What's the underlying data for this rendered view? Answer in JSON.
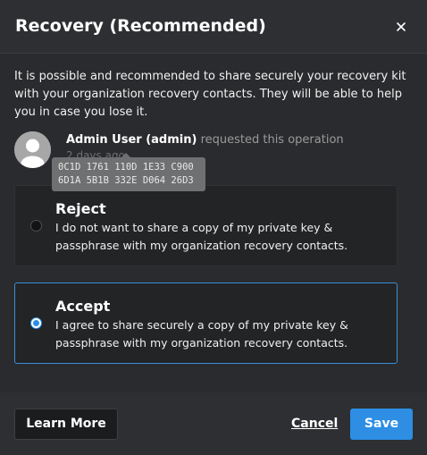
{
  "dialog": {
    "title": "Recovery (Recommended)",
    "close_icon": "close-icon"
  },
  "intro_text": "It is possible and recommended to share securely your recovery kit with your organization recovery contacts. They will be able to help you in case you lose it.",
  "requester": {
    "avatar_icon": "user-avatar-icon",
    "name": "Admin User (admin)",
    "action": "requested this operation",
    "time": "2 days ago",
    "fingerprint_line1": "0C1D 1761 110D 1E33 C900",
    "fingerprint_line2": "6D1A 5B1B 332E D064 26D3"
  },
  "options": {
    "reject": {
      "label": "Reject",
      "description": "I do not want to share a copy of my private key & passphrase with my organization recovery contacts.",
      "selected": false
    },
    "accept": {
      "label": "Accept",
      "description": "I agree to share securely a copy of my private key & passphrase with my organization recovery contacts.",
      "selected": true
    }
  },
  "footer": {
    "learn_more_label": "Learn More",
    "cancel_label": "Cancel",
    "save_label": "Save"
  },
  "colors": {
    "accent": "#2d8ee4",
    "background": "#2a2b2e",
    "option_background": "#232426"
  }
}
